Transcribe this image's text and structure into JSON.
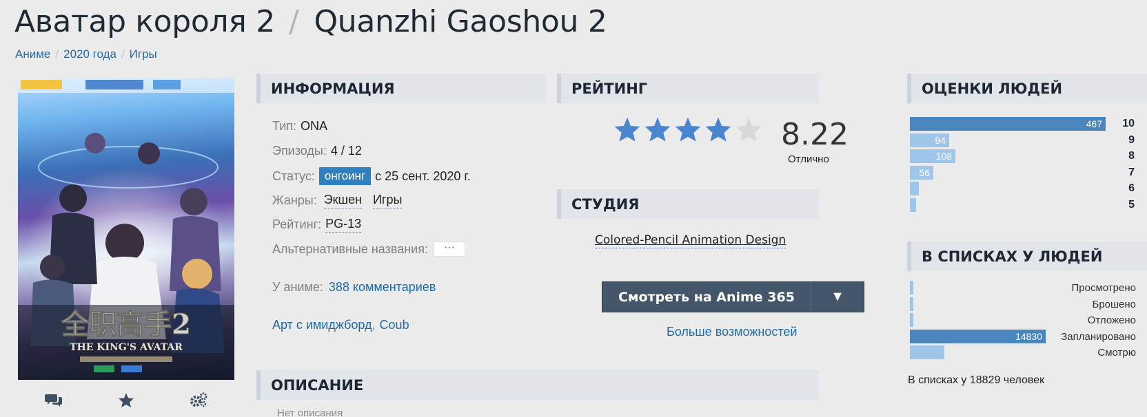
{
  "title": {
    "russian": "Аватар короля 2",
    "separator": "/",
    "original": "Quanzhi Gaoshou 2"
  },
  "breadcrumbs": [
    "Аниме",
    "2020 года",
    "Игры"
  ],
  "poster": {
    "logo_text": "全职高手2",
    "logo_en": "THE KING'S AVATAR"
  },
  "poster_actions": [
    "comments-icon",
    "star-icon",
    "gears-icon"
  ],
  "sections": {
    "info": "ИНФОРМАЦИЯ",
    "rating": "РЕЙТИНГ",
    "studio": "СТУДИЯ",
    "description": "ОПИСАНИЕ",
    "scores": "ОЦЕНКИ ЛЮДЕЙ",
    "lists": "В СПИСКАХ У ЛЮДЕЙ"
  },
  "info": {
    "type_label": "Тип:",
    "type_value": "ONA",
    "episodes_label": "Эпизоды:",
    "episodes_value": "4 / 12",
    "status_label": "Статус:",
    "status_badge": "онгоинг",
    "status_date": "с 25 сент. 2020 г.",
    "genres_label": "Жанры:",
    "genres": [
      "Экшен",
      "Игры"
    ],
    "rating_label": "Рейтинг:",
    "rating_value": "PG-13",
    "alt_names_label": "Альтернативные названия:",
    "alt_names_button": "···",
    "comments_label": "У аниме:",
    "comments_link": "388 комментариев",
    "links": [
      "Арт с имиджборд",
      "Coub"
    ],
    "links_sep": ","
  },
  "rating": {
    "score": "8.22",
    "stars_filled": 4,
    "stars_total": 5,
    "word": "Отлично"
  },
  "studio": "Colored-Pencil Animation Design",
  "watch": {
    "button": "Смотреть на Anime 365",
    "dropdown": "▼",
    "more": "Больше возможностей"
  },
  "description": "Нет описания",
  "scores": [
    {
      "score": "10",
      "count": 467,
      "label": "467"
    },
    {
      "score": "9",
      "count": 94,
      "label": "94"
    },
    {
      "score": "8",
      "count": 108,
      "label": "108"
    },
    {
      "score": "7",
      "count": 56,
      "label": "56"
    },
    {
      "score": "6",
      "count": 22,
      "label": ""
    },
    {
      "score": "5",
      "count": 15,
      "label": ""
    }
  ],
  "lists": [
    {
      "name": "Просмотрено",
      "count": 10,
      "label": ""
    },
    {
      "name": "Брошено",
      "count": 3,
      "label": ""
    },
    {
      "name": "Отложено",
      "count": 8,
      "label": ""
    },
    {
      "name": "Запланировано",
      "count": 14830,
      "label": "14830"
    },
    {
      "name": "Смотрю",
      "count": 3800,
      "label": ""
    }
  ],
  "lists_total": "В списках у 18829 человек",
  "colors": {
    "accent": "#2f80c1",
    "bar_dark": "#4a86bd",
    "bar_light": "#9fc5e8",
    "star_on": "#4a86cf",
    "star_off": "#d8d8d8",
    "button_bg": "#44566a"
  }
}
